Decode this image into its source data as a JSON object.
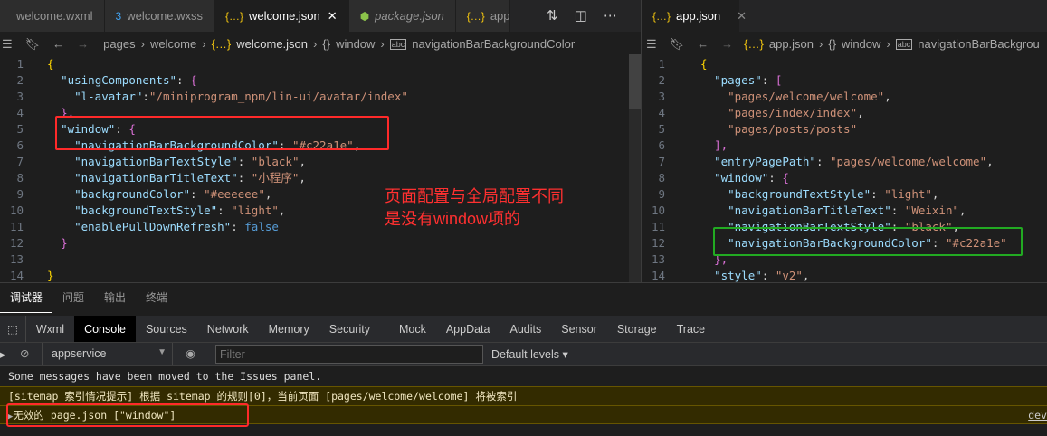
{
  "left_tabs": [
    {
      "label": "welcome.wxml",
      "icon": "wxml-file-icon",
      "ic": "</>",
      "color": "#8bc34a"
    },
    {
      "label": "welcome.wxss",
      "icon": "css-file-icon",
      "ic": "3",
      "color": "#42a5f5"
    },
    {
      "label": "welcome.json",
      "icon": "json-file-icon",
      "ic": "{…}",
      "color": "#f1c40f",
      "active": true
    },
    {
      "label": "package.json",
      "icon": "node-file-icon",
      "ic": "⬢",
      "color": "#8bc34a"
    },
    {
      "label": "app.j",
      "icon": "json-file-icon",
      "ic": "{…}",
      "color": "#f1c40f"
    }
  ],
  "left_breadcrumb": [
    "pages",
    "welcome",
    "welcome.json",
    "window",
    "navigationBarBackgroundColor"
  ],
  "right_tab": {
    "label": "app.json"
  },
  "right_breadcrumb": [
    "app.json",
    "window",
    "navigationBarBackgrou"
  ],
  "left_code": [
    [
      [
        "{",
        "b"
      ]
    ],
    [
      [
        "  ",
        ""
      ],
      [
        "\"usingComponents\"",
        "k"
      ],
      [
        ": ",
        "p"
      ],
      [
        "{",
        "m"
      ]
    ],
    [
      [
        "    ",
        ""
      ],
      [
        "\"l-avatar\"",
        "k"
      ],
      [
        ":",
        "p"
      ],
      [
        "\"/miniprogram_npm/lin-ui/avatar/index\"",
        "s"
      ]
    ],
    [
      [
        "  ",
        ""
      ],
      [
        "},",
        "m"
      ]
    ],
    [
      [
        "  ",
        ""
      ],
      [
        "\"window\"",
        "k"
      ],
      [
        ": ",
        "p"
      ],
      [
        "{",
        "m"
      ]
    ],
    [
      [
        "    ",
        ""
      ],
      [
        "\"navigationBarBackgroundColor\"",
        "k"
      ],
      [
        ": ",
        "p"
      ],
      [
        "\"#c22a1e\"",
        "s"
      ],
      [
        ",",
        "p"
      ]
    ],
    [
      [
        "    ",
        ""
      ],
      [
        "\"navigationBarTextStyle\"",
        "k"
      ],
      [
        ": ",
        "p"
      ],
      [
        "\"black\"",
        "s"
      ],
      [
        ",",
        "p"
      ]
    ],
    [
      [
        "    ",
        ""
      ],
      [
        "\"navigationBarTitleText\"",
        "k"
      ],
      [
        ": ",
        "p"
      ],
      [
        "\"小程序\"",
        "s"
      ],
      [
        ",",
        "p"
      ]
    ],
    [
      [
        "    ",
        ""
      ],
      [
        "\"backgroundColor\"",
        "k"
      ],
      [
        ": ",
        "p"
      ],
      [
        "\"#eeeeee\"",
        "s"
      ],
      [
        ",",
        "p"
      ]
    ],
    [
      [
        "    ",
        ""
      ],
      [
        "\"backgroundTextStyle\"",
        "k"
      ],
      [
        ": ",
        "p"
      ],
      [
        "\"light\"",
        "s"
      ],
      [
        ",",
        "p"
      ]
    ],
    [
      [
        "    ",
        ""
      ],
      [
        "\"enablePullDownRefresh\"",
        "k"
      ],
      [
        ": ",
        "p"
      ],
      [
        "false",
        "kw"
      ]
    ],
    [
      [
        "  ",
        ""
      ],
      [
        "}",
        "m"
      ]
    ],
    [
      [
        "",
        ""
      ]
    ],
    [
      [
        "}",
        "b"
      ]
    ]
  ],
  "right_code": [
    [
      [
        "{",
        "b"
      ]
    ],
    [
      [
        "  ",
        ""
      ],
      [
        "\"pages\"",
        "k"
      ],
      [
        ": ",
        "p"
      ],
      [
        "[",
        "m"
      ]
    ],
    [
      [
        "    ",
        ""
      ],
      [
        "\"pages/welcome/welcome\"",
        "s"
      ],
      [
        ",",
        "p"
      ]
    ],
    [
      [
        "    ",
        ""
      ],
      [
        "\"pages/index/index\"",
        "s"
      ],
      [
        ",",
        "p"
      ]
    ],
    [
      [
        "    ",
        ""
      ],
      [
        "\"pages/posts/posts\"",
        "s"
      ]
    ],
    [
      [
        "  ",
        ""
      ],
      [
        "],",
        "m"
      ]
    ],
    [
      [
        "  ",
        ""
      ],
      [
        "\"entryPagePath\"",
        "k"
      ],
      [
        ": ",
        "p"
      ],
      [
        "\"pages/welcome/welcome\"",
        "s"
      ],
      [
        ",",
        "p"
      ]
    ],
    [
      [
        "  ",
        ""
      ],
      [
        "\"window\"",
        "k"
      ],
      [
        ": ",
        "p"
      ],
      [
        "{",
        "m"
      ]
    ],
    [
      [
        "    ",
        ""
      ],
      [
        "\"backgroundTextStyle\"",
        "k"
      ],
      [
        ": ",
        "p"
      ],
      [
        "\"light\"",
        "s"
      ],
      [
        ",",
        "p"
      ]
    ],
    [
      [
        "    ",
        ""
      ],
      [
        "\"navigationBarTitleText\"",
        "k"
      ],
      [
        ": ",
        "p"
      ],
      [
        "\"Weixin\"",
        "s"
      ],
      [
        ",",
        "p"
      ]
    ],
    [
      [
        "    ",
        ""
      ],
      [
        "\"navigationBarTextStyle\"",
        "k"
      ],
      [
        ": ",
        "p"
      ],
      [
        "\"black\"",
        "s"
      ],
      [
        ",",
        "p"
      ]
    ],
    [
      [
        "    ",
        ""
      ],
      [
        "\"navigationBarBackgroundColor\"",
        "k"
      ],
      [
        ": ",
        "p"
      ],
      [
        "\"#c22a1e\"",
        "s"
      ]
    ],
    [
      [
        "  ",
        ""
      ],
      [
        "},",
        "m"
      ]
    ],
    [
      [
        "  ",
        ""
      ],
      [
        "\"style\"",
        "k"
      ],
      [
        ": ",
        "p"
      ],
      [
        "\"v2\"",
        "s"
      ],
      [
        ",",
        "p"
      ]
    ]
  ],
  "annotation": [
    "页面配置与全局配置不同",
    "是没有window项的"
  ],
  "panel_tabs": [
    "调试器",
    "问题",
    "输出",
    "终端"
  ],
  "devtools_tabs": [
    "Wxml",
    "Console",
    "Sources",
    "Network",
    "Memory",
    "Security",
    "Mock",
    "AppData",
    "Audits",
    "Sensor",
    "Storage",
    "Trace"
  ],
  "console": {
    "context": "appservice",
    "filter_placeholder": "Filter",
    "levels": "Default levels ▾",
    "messages": [
      "Some messages have been moved to the Issues panel.",
      "[sitemap 索引情况提示] 根据 sitemap 的规则[0]，当前页面 [pages/welcome/welcome] 将被索引",
      "无效的 page.json [\"window\"]"
    ],
    "link": "dev"
  },
  "colors": {
    "red_box": "#ff2a2a",
    "green_box": "#22aa22",
    "annotation": "#ff3030"
  }
}
